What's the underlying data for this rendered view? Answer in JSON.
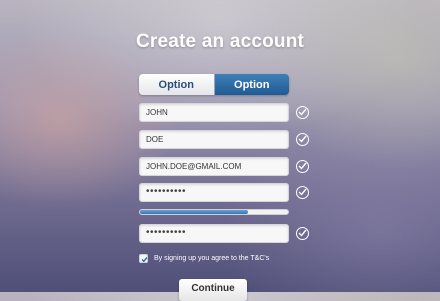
{
  "header": {
    "title": "Create an account"
  },
  "segmented": {
    "options": [
      {
        "label": "Option",
        "selected": false
      },
      {
        "label": "Option",
        "selected": true
      }
    ]
  },
  "form": {
    "first_name": "JOHN",
    "last_name": "DOE",
    "email": "JOHN.DOE@GMAIL.COM",
    "password": "••••••••••",
    "password_confirm": "••••••••••",
    "password_strength": 0.73
  },
  "terms": {
    "label": "By signing up you agree to the T&C's",
    "checked": true
  },
  "actions": {
    "continue_label": "Continue"
  },
  "colors": {
    "accent": "#2e6aa6",
    "check_border": "#ffffff"
  },
  "icons": {
    "valid": "checkmark-icon",
    "checkbox": "checkbox-checked-icon"
  }
}
